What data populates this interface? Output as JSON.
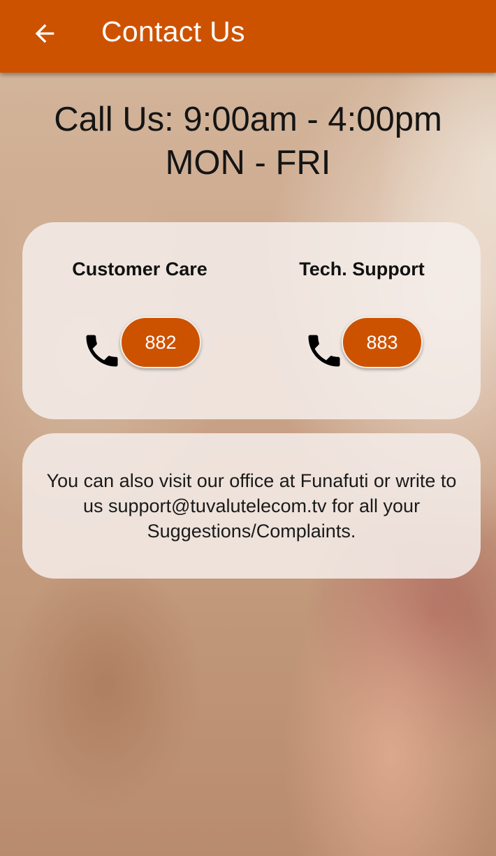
{
  "header": {
    "title": "Contact Us",
    "back_icon": "arrow-left-icon"
  },
  "hours": {
    "line1": "Call Us: 9:00am - 4:00pm",
    "line2": "MON - FRI"
  },
  "contacts": [
    {
      "label": "Customer Care",
      "number": "882",
      "icon": "phone-icon"
    },
    {
      "label": "Tech. Support",
      "number": "883",
      "icon": "phone-icon"
    }
  ],
  "info": {
    "text": "You can also visit our office at Funafuti or write to us support@tuvalutelecom.tv for all your Suggestions/Complaints."
  },
  "colors": {
    "accent": "#cd5200",
    "card": "#f5eeea",
    "text": "#141414"
  }
}
